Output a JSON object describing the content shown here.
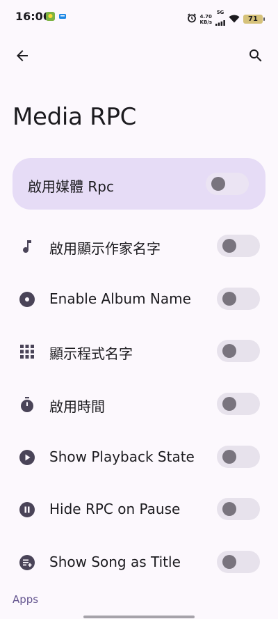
{
  "status_bar": {
    "time": "16:06",
    "net_speed_value": "4.70",
    "net_speed_unit": "KB/s",
    "network": "5G",
    "battery": "71"
  },
  "header": {
    "back_icon": "arrow-back-icon",
    "search_icon": "search-icon"
  },
  "page": {
    "title": "Media RPC"
  },
  "master": {
    "label": "啟用媒體 Rpc",
    "enabled": false
  },
  "settings": [
    {
      "icon": "music-note-icon",
      "label": "啟用顯示作家名字",
      "enabled": false
    },
    {
      "icon": "album-icon",
      "label": "Enable Album Name",
      "enabled": false
    },
    {
      "icon": "apps-grid-icon",
      "label": "顯示程式名字",
      "enabled": false
    },
    {
      "icon": "timer-icon",
      "label": "啟用時間",
      "enabled": false
    },
    {
      "icon": "play-circle-icon",
      "label": "Show Playback State",
      "enabled": false
    },
    {
      "icon": "pause-circle-icon",
      "label": "Hide RPC on Pause",
      "enabled": false
    },
    {
      "icon": "playlist-add-icon",
      "label": "Show Song as Title",
      "enabled": false
    }
  ],
  "sections": {
    "apps_header": "Apps"
  },
  "colors": {
    "background": "#fcf8fd",
    "card": "#e6dcf6",
    "icon": "#4a4458",
    "switch_track": "#e7e2ec",
    "switch_thumb": "#79747e",
    "section_header": "#64558f"
  }
}
